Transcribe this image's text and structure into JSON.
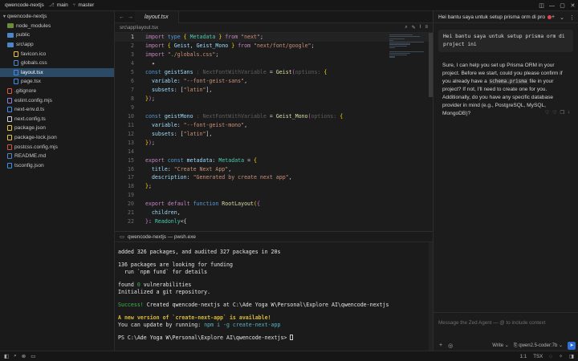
{
  "titlebar": {
    "project": "qwencode-nextjs",
    "branch_icon": "branch-icon",
    "branch_main": "main",
    "git_icon": "git-icon",
    "branch_master": "master",
    "window_controls": [
      "◫",
      "—",
      "▢",
      "✕"
    ]
  },
  "sidebar": {
    "root": "qwencode-nextjs",
    "items": [
      {
        "label": "node_modules",
        "kind": "folder",
        "depth": 1,
        "color": "#6b8c3a"
      },
      {
        "label": "public",
        "kind": "folder",
        "depth": 1,
        "color": "#4a87c9"
      },
      {
        "label": "src\\app",
        "kind": "folder-open",
        "depth": 1,
        "color": "#4a87c9"
      },
      {
        "label": "favicon.ico",
        "kind": "file",
        "depth": 2,
        "color": "#e8c33c"
      },
      {
        "label": "globals.css",
        "kind": "file",
        "depth": 2,
        "color": "#4a87c9"
      },
      {
        "label": "layout.tsx",
        "kind": "file",
        "depth": 2,
        "color": "#3b8eea",
        "active": true
      },
      {
        "label": "page.tsx",
        "kind": "file",
        "depth": 2,
        "color": "#3b8eea"
      },
      {
        "label": ".gitignore",
        "kind": "file",
        "depth": 1,
        "color": "#e0553c"
      },
      {
        "label": "eslint.config.mjs",
        "kind": "file",
        "depth": 1,
        "color": "#8c7bd6"
      },
      {
        "label": "next-env.d.ts",
        "kind": "file",
        "depth": 1,
        "color": "#3b8eea"
      },
      {
        "label": "next.config.ts",
        "kind": "file",
        "depth": 1,
        "color": "#d0d0d0"
      },
      {
        "label": "package.json",
        "kind": "file",
        "depth": 1,
        "color": "#e8c33c"
      },
      {
        "label": "package-lock.json",
        "kind": "file",
        "depth": 1,
        "color": "#e8c33c"
      },
      {
        "label": "postcss.config.mjs",
        "kind": "file",
        "depth": 1,
        "color": "#d6523c"
      },
      {
        "label": "README.md",
        "kind": "file",
        "depth": 1,
        "color": "#4a87c9"
      },
      {
        "label": "tsconfig.json",
        "kind": "file",
        "depth": 1,
        "color": "#3b8eea"
      }
    ]
  },
  "editor": {
    "tab_label": "layout.tsx",
    "breadcrumb": "src\\app\\layout.tsx",
    "lines": [
      {
        "n": "1",
        "cur": true,
        "tokens": [
          [
            "kw",
            "import "
          ],
          [
            "kw2",
            "type "
          ],
          [
            "brace",
            "{ "
          ],
          [
            "type",
            "Metadata"
          ],
          [
            "brace",
            " }"
          ],
          [
            "kw",
            " from "
          ],
          [
            "str",
            "\"next\""
          ],
          [
            "pun",
            ";"
          ]
        ]
      },
      {
        "n": "2",
        "tokens": [
          [
            "kw",
            "import "
          ],
          [
            "brace",
            "{ "
          ],
          [
            "prop",
            "Geist"
          ],
          [
            "pun",
            ", "
          ],
          [
            "prop",
            "Geist_Mono"
          ],
          [
            "brace",
            " }"
          ],
          [
            "kw",
            " from "
          ],
          [
            "str",
            "\"next/font/google\""
          ],
          [
            "pun",
            ";"
          ]
        ]
      },
      {
        "n": "3",
        "tokens": [
          [
            "kw",
            "import "
          ],
          [
            "str",
            "\"./globals.css\""
          ],
          [
            "pun",
            ";"
          ]
        ]
      },
      {
        "n": "4",
        "tokens": [
          [
            "pun",
            "  ✦"
          ]
        ]
      },
      {
        "n": "5",
        "tokens": [
          [
            "kw2",
            "const "
          ],
          [
            "prop",
            "geistSans"
          ],
          [
            "hint",
            " : NextFontWithVariable"
          ],
          [
            "pun",
            " = "
          ],
          [
            "fn",
            "Geist"
          ],
          [
            "brace2",
            "("
          ],
          [
            "hint",
            "options: "
          ],
          [
            "brace",
            "{"
          ]
        ]
      },
      {
        "n": "6",
        "tokens": [
          [
            "prop",
            "  variable"
          ],
          [
            "pun",
            ": "
          ],
          [
            "str",
            "\"--font-geist-sans\""
          ],
          [
            "pun",
            ","
          ]
        ]
      },
      {
        "n": "7",
        "tokens": [
          [
            "prop",
            "  subsets"
          ],
          [
            "pun",
            ": ["
          ],
          [
            "str",
            "\"latin\""
          ],
          [
            "pun",
            "],"
          ]
        ]
      },
      {
        "n": "8",
        "tokens": [
          [
            "brace",
            "}"
          ],
          [
            "brace2",
            ")"
          ],
          [
            "pun",
            ";"
          ]
        ]
      },
      {
        "n": "9",
        "tokens": [
          [
            "pun",
            ""
          ]
        ]
      },
      {
        "n": "10",
        "tokens": [
          [
            "kw2",
            "const "
          ],
          [
            "prop",
            "geistMono"
          ],
          [
            "hint",
            " : NextFontWithVariable"
          ],
          [
            "pun",
            " = "
          ],
          [
            "fn",
            "Geist_Mono"
          ],
          [
            "brace2",
            "("
          ],
          [
            "hint",
            "options: "
          ],
          [
            "brace",
            "{"
          ]
        ]
      },
      {
        "n": "11",
        "tokens": [
          [
            "prop",
            "  variable"
          ],
          [
            "pun",
            ": "
          ],
          [
            "str",
            "\"--font-geist-mono\""
          ],
          [
            "pun",
            ","
          ]
        ]
      },
      {
        "n": "12",
        "tokens": [
          [
            "prop",
            "  subsets"
          ],
          [
            "pun",
            ": ["
          ],
          [
            "str",
            "\"latin\""
          ],
          [
            "pun",
            "],"
          ]
        ]
      },
      {
        "n": "13",
        "tokens": [
          [
            "brace",
            "}"
          ],
          [
            "brace2",
            ")"
          ],
          [
            "pun",
            ";"
          ]
        ]
      },
      {
        "n": "14",
        "tokens": [
          [
            "pun",
            ""
          ]
        ]
      },
      {
        "n": "15",
        "tokens": [
          [
            "kw",
            "export "
          ],
          [
            "kw2",
            "const "
          ],
          [
            "prop",
            "metadata"
          ],
          [
            "pun",
            ": "
          ],
          [
            "type",
            "Metadata"
          ],
          [
            "pun",
            " = "
          ],
          [
            "brace",
            "{"
          ]
        ]
      },
      {
        "n": "16",
        "tokens": [
          [
            "prop",
            "  title"
          ],
          [
            "pun",
            ": "
          ],
          [
            "str",
            "\"Create Next App\""
          ],
          [
            "pun",
            ","
          ]
        ]
      },
      {
        "n": "17",
        "tokens": [
          [
            "prop",
            "  description"
          ],
          [
            "pun",
            ": "
          ],
          [
            "str",
            "\"Generated by create next app\""
          ],
          [
            "pun",
            ","
          ]
        ]
      },
      {
        "n": "18",
        "tokens": [
          [
            "brace",
            "}"
          ],
          [
            "pun",
            ";"
          ]
        ]
      },
      {
        "n": "19",
        "tokens": [
          [
            "pun",
            ""
          ]
        ]
      },
      {
        "n": "20",
        "tokens": [
          [
            "kw",
            "export "
          ],
          [
            "kw",
            "default "
          ],
          [
            "kw2",
            "function "
          ],
          [
            "fn",
            "RootLayout"
          ],
          [
            "brace",
            "("
          ],
          [
            "brace2",
            "{"
          ]
        ]
      },
      {
        "n": "21",
        "tokens": [
          [
            "prop",
            "  children"
          ],
          [
            "pun",
            ","
          ]
        ]
      },
      {
        "n": "22",
        "tokens": [
          [
            "brace2",
            "}"
          ],
          [
            "pun",
            ": "
          ],
          [
            "type",
            "Readonly"
          ],
          [
            "pun",
            "<{"
          ]
        ]
      }
    ]
  },
  "terminal": {
    "tab_label": "qwencode-nextjs — pwsh.exe",
    "lines": [
      [
        [
          "white",
          "added 326 packages, and audited 327 packages in 20s"
        ]
      ],
      "gap",
      [
        [
          "white",
          "136 packages are looking for funding"
        ]
      ],
      [
        [
          "white",
          "  run `npm fund` for details"
        ]
      ],
      "gap",
      [
        [
          "white",
          "found "
        ],
        [
          "green",
          "0"
        ],
        [
          "white",
          " vulnerabilities"
        ]
      ],
      [
        [
          "white",
          "Initialized a git repository."
        ]
      ],
      "gap",
      [
        [
          "green",
          "Success!"
        ],
        [
          "white",
          " Created qwencode-nextjs at C:\\Ade Yoga W\\Personal\\Explore AI\\qwencode-nextjs"
        ]
      ],
      "gap",
      [
        [
          "yellow",
          "A new version of `create-next-app` is available!"
        ]
      ],
      [
        [
          "white",
          "You can update by running: "
        ],
        [
          "cyan",
          "npm i -g create-next-app"
        ]
      ],
      "gap",
      [
        [
          "white",
          "PS C:\\Ade Yoga W\\Personal\\Explore AI\\qwencode-nextjs> "
        ],
        [
          "cursor",
          ""
        ]
      ]
    ]
  },
  "agent": {
    "title": "Hei bantu saya untuk setup prisma orm di pro",
    "user_message": "Hei bantu saya untuk setup prisma orm di project ini",
    "reply_before": "Sure, I can help you set up Prisma ORM in your project. Before we start, could you please confirm if you already have a ",
    "reply_code": "schema.prisma",
    "reply_after": " file in your project? If not, I'll need to create one for you. Additionally, do you have any specific database provider in mind (e.g., PostgreSQL, MySQL, MongoDB)?",
    "input_placeholder": "Message the Zed Agent — @ to include context",
    "mode_label": "Write",
    "model_label": "qwen2.5-coder:7b"
  },
  "statusbar": {
    "position": "1:1",
    "language": "TSX"
  }
}
